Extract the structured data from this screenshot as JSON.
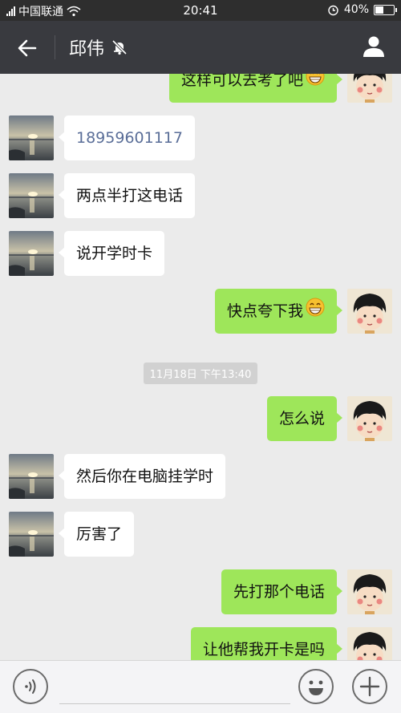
{
  "status_bar": {
    "carrier": "中国联通",
    "time": "20:41",
    "battery_text": "40%",
    "battery_level": 0.4,
    "icons": [
      "signal-icon",
      "wifi-icon",
      "alarm-icon",
      "battery-icon"
    ]
  },
  "header": {
    "title": "邱伟",
    "back_icon": "back-arrow-icon",
    "mute_icon": "mute-bell-icon",
    "profile_icon": "profile-icon"
  },
  "messages": [
    {
      "side": "out",
      "text": "这样可以去考了吧",
      "emoji": "grin"
    },
    {
      "side": "in",
      "text": "18959601117",
      "link": true
    },
    {
      "side": "in",
      "text": "两点半打这电话"
    },
    {
      "side": "in",
      "text": "说开学时卡"
    },
    {
      "side": "out",
      "text": "快点夸下我",
      "emoji": "grin"
    },
    {
      "side": "time",
      "text": "11月18日 下午13:40"
    },
    {
      "side": "out",
      "text": "怎么说"
    },
    {
      "side": "in",
      "text": "然后你在电脑挂学时"
    },
    {
      "side": "in",
      "text": "厉害了"
    },
    {
      "side": "out",
      "text": "先打那个电话"
    },
    {
      "side": "out",
      "text": "让他帮我开卡是吗"
    }
  ],
  "input_bar": {
    "placeholder": "",
    "icons": [
      "voice-icon",
      "emoji-icon",
      "plus-icon"
    ]
  },
  "colors": {
    "status_bg": "#2e2e2e",
    "title_bg": "#393a3f",
    "chat_bg": "#ebebeb",
    "outgoing_bubble": "#9ee65a",
    "incoming_bubble": "#ffffff",
    "link_text": "#5a6e98"
  }
}
